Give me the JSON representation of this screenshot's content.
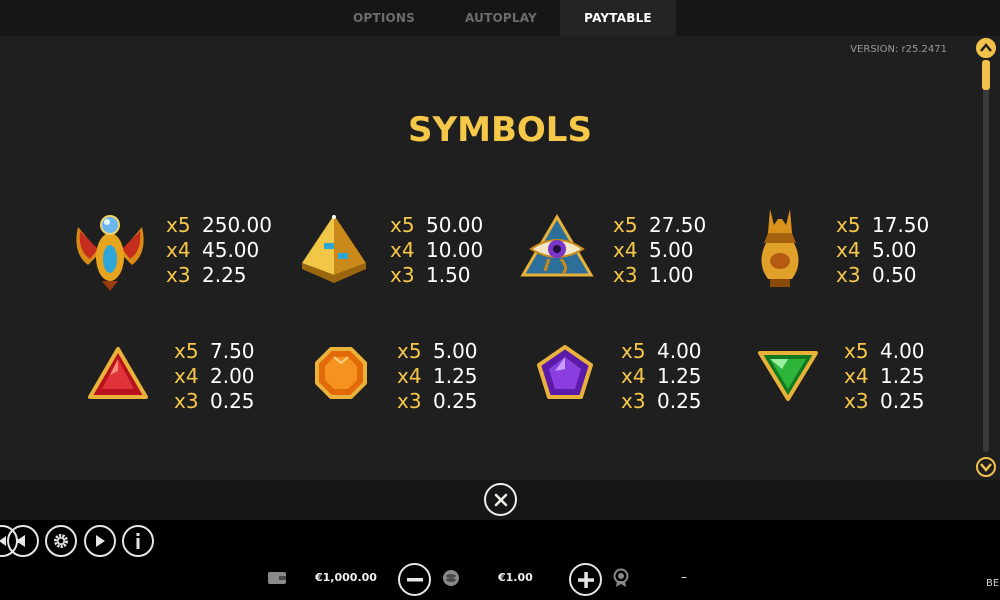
{
  "tabs": [
    {
      "label": "OPTIONS",
      "active": false
    },
    {
      "label": "AUTOPLAY",
      "active": false
    },
    {
      "label": "PAYTABLE",
      "active": true
    }
  ],
  "version": "VERSION: r25.2471",
  "heading": "SYMBOLS",
  "symbols": [
    {
      "icon": "scarab-icon",
      "pays": [
        {
          "count": "x5",
          "value": "250.00"
        },
        {
          "count": "x4",
          "value": "45.00"
        },
        {
          "count": "x3",
          "value": "2.25"
        }
      ]
    },
    {
      "icon": "pyramid-icon",
      "pays": [
        {
          "count": "x5",
          "value": "50.00"
        },
        {
          "count": "x4",
          "value": "10.00"
        },
        {
          "count": "x3",
          "value": "1.50"
        }
      ]
    },
    {
      "icon": "eye-of-horus-icon",
      "pays": [
        {
          "count": "x5",
          "value": "27.50"
        },
        {
          "count": "x4",
          "value": "5.00"
        },
        {
          "count": "x3",
          "value": "1.00"
        }
      ]
    },
    {
      "icon": "anubis-vase-icon",
      "pays": [
        {
          "count": "x5",
          "value": "17.50"
        },
        {
          "count": "x4",
          "value": "5.00"
        },
        {
          "count": "x3",
          "value": "0.50"
        }
      ]
    },
    {
      "icon": "red-gem-icon",
      "pays": [
        {
          "count": "x5",
          "value": "7.50"
        },
        {
          "count": "x4",
          "value": "2.00"
        },
        {
          "count": "x3",
          "value": "0.25"
        }
      ]
    },
    {
      "icon": "orange-gem-icon",
      "pays": [
        {
          "count": "x5",
          "value": "5.00"
        },
        {
          "count": "x4",
          "value": "1.25"
        },
        {
          "count": "x3",
          "value": "0.25"
        }
      ]
    },
    {
      "icon": "purple-gem-icon",
      "pays": [
        {
          "count": "x5",
          "value": "4.00"
        },
        {
          "count": "x4",
          "value": "1.25"
        },
        {
          "count": "x3",
          "value": "0.25"
        }
      ]
    },
    {
      "icon": "green-gem-icon",
      "pays": [
        {
          "count": "x5",
          "value": "4.00"
        },
        {
          "count": "x4",
          "value": "1.25"
        },
        {
          "count": "x3",
          "value": "0.25"
        }
      ]
    }
  ],
  "bottom": {
    "balance": "€1,000.00",
    "bet": "€1.00",
    "win": "–",
    "brand": "BE"
  },
  "colors": {
    "accent": "#f6c84a",
    "panel": "#1f1f1f",
    "bar": "#161616"
  }
}
